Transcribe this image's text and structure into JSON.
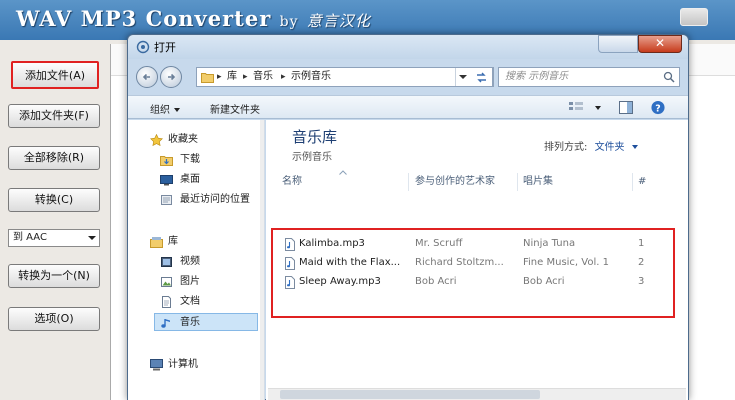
{
  "app": {
    "title_main": "WAV MP3 Converter",
    "title_by": "by",
    "title_brand": "意言汉化",
    "buttons": [
      "添加文件(A)",
      "添加文件夹(F)",
      "全部移除(R)",
      "转换(C)"
    ],
    "format_select": "到 AAC",
    "buttons2": [
      "转换为一个(N)",
      "选项(O)"
    ]
  },
  "dialog": {
    "title": "打开",
    "breadcrumb": [
      "库",
      "音乐",
      "示例音乐"
    ],
    "search_placeholder": "搜索 示例音乐",
    "toolbar": {
      "organize": "组织",
      "new_folder": "新建文件夹"
    },
    "nav": {
      "favorites": "收藏夹",
      "favorites_items": [
        "下载",
        "桌面",
        "最近访问的位置"
      ],
      "libraries": "库",
      "libraries_items": [
        "视频",
        "图片",
        "文档",
        "音乐"
      ],
      "computer": "计算机"
    },
    "library": {
      "title": "音乐库",
      "subtitle": "示例音乐",
      "arrange_label": "排列方式:",
      "arrange_value": "文件夹"
    },
    "columns": [
      "名称",
      "参与创作的艺术家",
      "唱片集",
      "#"
    ],
    "files": [
      {
        "name": "Kalimba.mp3",
        "artist": "Mr. Scruff",
        "album": "Ninja Tuna",
        "num": "1"
      },
      {
        "name": "Maid with the Flax...",
        "artist": "Richard Stoltzm...",
        "album": "Fine Music, Vol. 1",
        "num": "2"
      },
      {
        "name": "Sleep Away.mp3",
        "artist": "Bob Acri",
        "album": "Bob Acri",
        "num": "3"
      }
    ]
  },
  "colors": {
    "highlight_red": "#e02121",
    "accent_blue": "#1e3f73"
  }
}
